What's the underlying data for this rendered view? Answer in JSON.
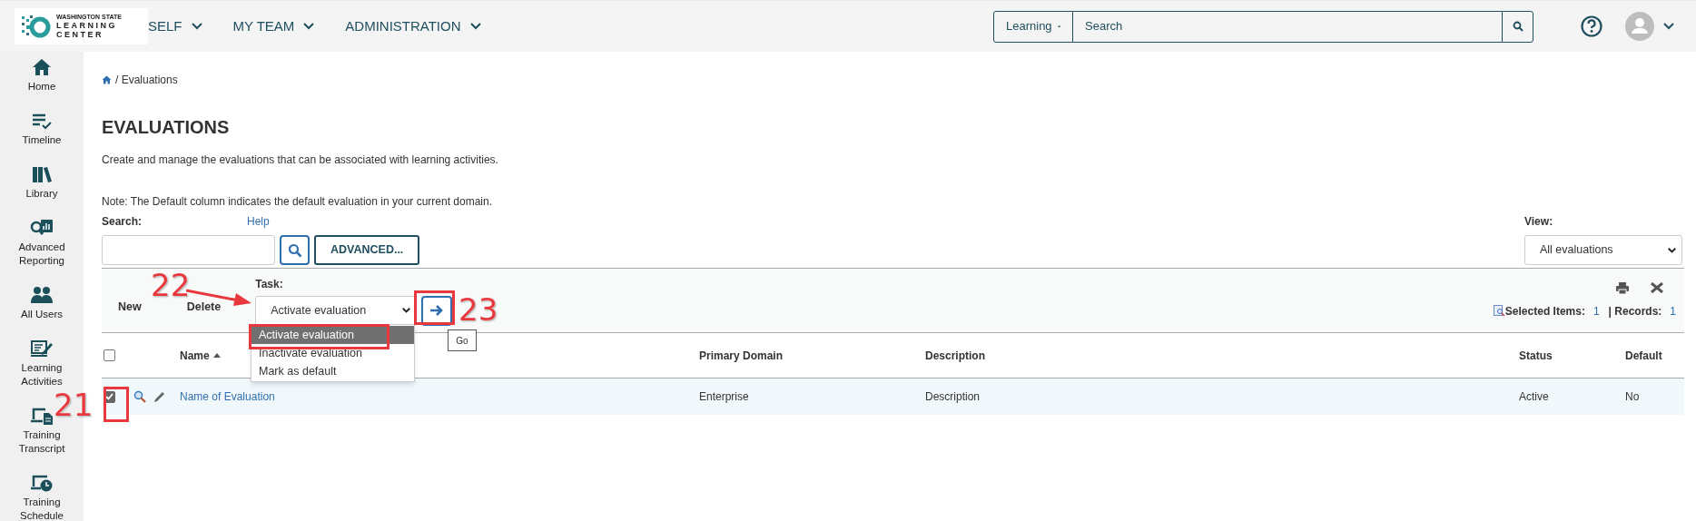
{
  "top_bar": {
    "logo": {
      "small_text": "WASHINGTON STATE",
      "line_1": "LEARNING",
      "line_2": "CENTER"
    },
    "nav_menus": [
      {
        "label": "SELF"
      },
      {
        "label": "MY TEAM"
      },
      {
        "label": "ADMINISTRATION"
      }
    ],
    "search": {
      "scope": "Learning",
      "placeholder": "Search"
    }
  },
  "sidebar": {
    "items": [
      {
        "label": "Home"
      },
      {
        "label": "Timeline"
      },
      {
        "label": "Library"
      },
      {
        "label": "Advanced Reporting"
      },
      {
        "label": "All Users"
      },
      {
        "label": "Learning Activities"
      },
      {
        "label": "Training Transcript"
      },
      {
        "label": "Training Schedule"
      }
    ]
  },
  "breadcrumb": "/ Evaluations",
  "page": {
    "title": "EVALUATIONS",
    "description": "Create and manage the evaluations that can be associated with learning activities.",
    "note": "Note: The Default column indicates the default evaluation in your current domain."
  },
  "search_panel": {
    "label": "Search:",
    "help_link": "Help",
    "advanced_button": "ADVANCED...",
    "view_label": "View:",
    "view_value": "All evaluations"
  },
  "toolbar": {
    "new": "New",
    "delete": "Delete",
    "task_label": "Task:",
    "task_value": "Activate evaluation",
    "task_options": [
      {
        "label": "Activate evaluation",
        "selected": true
      },
      {
        "label": "Inactivate evaluation",
        "selected": false
      },
      {
        "label": "Mark as default",
        "selected": false
      }
    ],
    "go_tooltip": "Go",
    "selected_label": "Selected Items:",
    "selected_value": "1",
    "records_label": "| Records:",
    "records_value": "1"
  },
  "table": {
    "header_checked": false,
    "columns": [
      "Name",
      "Primary Domain",
      "Description",
      "Status",
      "Default"
    ],
    "rows": [
      {
        "checked": true,
        "name": "Name of Evaluation",
        "primary_domain": "Enterprise",
        "description": "Description",
        "status": "Active",
        "default": "No"
      }
    ]
  },
  "annotations": [
    {
      "label": "22"
    },
    {
      "label": "23"
    },
    {
      "label": "21"
    }
  ]
}
